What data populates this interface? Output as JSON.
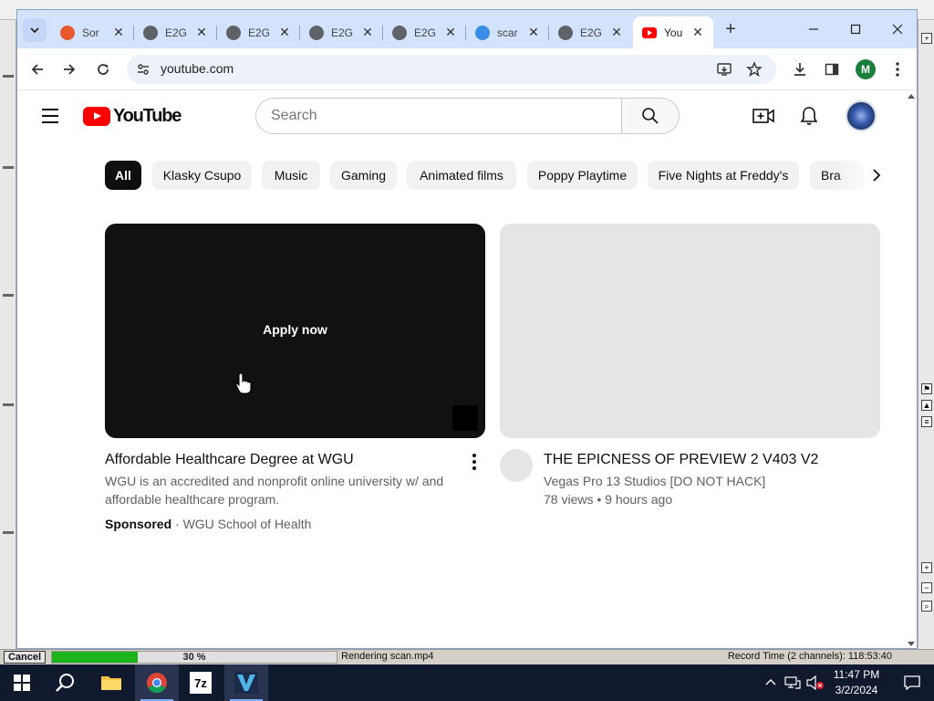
{
  "background_app": {
    "render_bar": {
      "cancel_label": "Cancel",
      "progress_percent_label": "30 %",
      "progress_fraction": 0.3,
      "status": "Rendering scan.mp4",
      "record_time": "Record Time (2 channels): 118:53:40"
    }
  },
  "taskbar": {
    "items": [
      "start",
      "search",
      "file-explorer",
      "chrome",
      "7-zip",
      "vegas-pro"
    ],
    "seven_zip_label": "7z",
    "clock_time": "11:47 PM",
    "clock_date": "3/2/2024"
  },
  "browser": {
    "tabs": [
      {
        "title": "Sor",
        "favicon_color": "#e8582d",
        "active": false
      },
      {
        "title": "E2G",
        "favicon_color": "#5f6368",
        "active": false
      },
      {
        "title": "E2G",
        "favicon_color": "#5f6368",
        "active": false
      },
      {
        "title": "E2G",
        "favicon_color": "#5f6368",
        "active": false
      },
      {
        "title": "E2G",
        "favicon_color": "#5f6368",
        "active": false
      },
      {
        "title": "scar",
        "favicon_color": "#3a8ee6",
        "active": false
      },
      {
        "title": "E2G",
        "favicon_color": "#5f6368",
        "active": false
      },
      {
        "title": "You",
        "favicon_color": "#ff0000",
        "active": true
      }
    ],
    "url": "youtube.com",
    "profile_initial": "M",
    "accent": "#d3e3fd"
  },
  "youtube": {
    "logo_text": "YouTube",
    "search_placeholder": "Search",
    "chips": [
      "All",
      "Klasky Csupo",
      "Music",
      "Gaming",
      "Animated films",
      "Poppy Playtime",
      "Five Nights at Freddy's",
      "Bra"
    ],
    "videos": [
      {
        "type": "ad",
        "overlay_label": "Apply now",
        "title": "Affordable Healthcare Degree at WGU",
        "description": "WGU is an accredited and nonprofit online university w/ and affordable healthcare program.",
        "sponsored_label": "Sponsored",
        "separator": "·",
        "advertiser": "WGU School of Health"
      },
      {
        "type": "video",
        "title": "THE EPICNESS OF PREVIEW 2 V403 V2",
        "channel": "Vegas Pro 13 Studios [DO NOT HACK]",
        "views": "78 views",
        "separator": "•",
        "age": "9 hours ago"
      }
    ]
  }
}
